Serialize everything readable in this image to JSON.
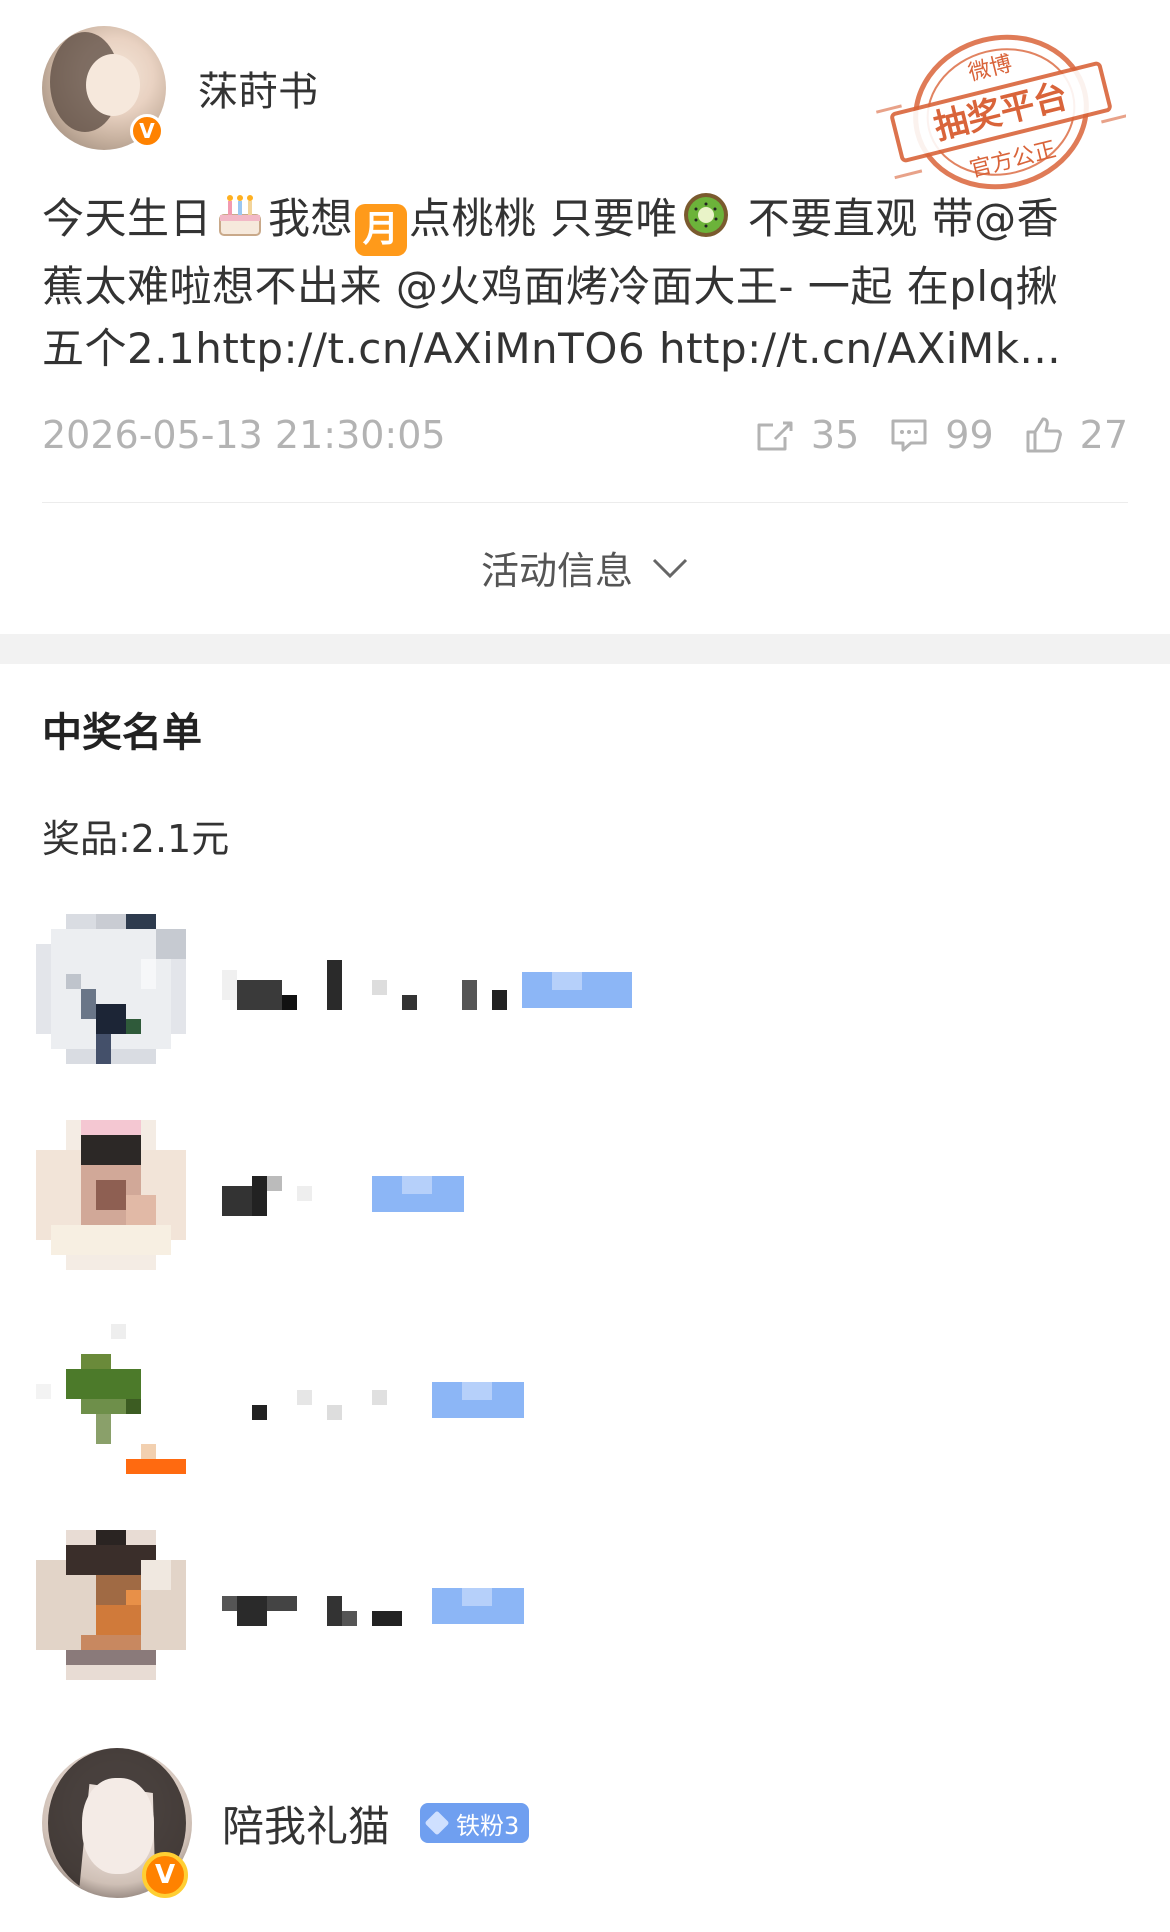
{
  "post": {
    "author": {
      "name": "莯莳书",
      "verified_badge": "V"
    },
    "stamp": {
      "top": "微博",
      "main": "抽奖平台",
      "bottom": "官方公正"
    },
    "text": {
      "line1_a": "今天生日",
      "line1_b": "我想",
      "moon_emoji_char": "月",
      "line1_c": "点桃桃 只要唯",
      "line1_d": " 不要直观 带@香",
      "line2": "蕉太难啦想不出来 @火鸡面烤冷面大王- 一起 在plq揪",
      "line3": "五个2.1http://t.cn/AXiMnTO6  http://t.cn/AXiMk..."
    },
    "timestamp": "2026-05-13 21:30:05",
    "stats": {
      "reposts": "35",
      "comments": "99",
      "likes": "27"
    },
    "activity_label": "活动信息"
  },
  "winners": {
    "title": "中奖名单",
    "prize": "奖品:2.1元"
  },
  "commenter": {
    "name": "陪我礼猫",
    "fan_badge": "铁粉3",
    "verified_badge": "V"
  },
  "colors": {
    "accent_orange": "#ff8200",
    "stamp_red": "#d9643a",
    "meta_gray": "#b3b3b3",
    "fan_blue": "#6f9ff0"
  }
}
